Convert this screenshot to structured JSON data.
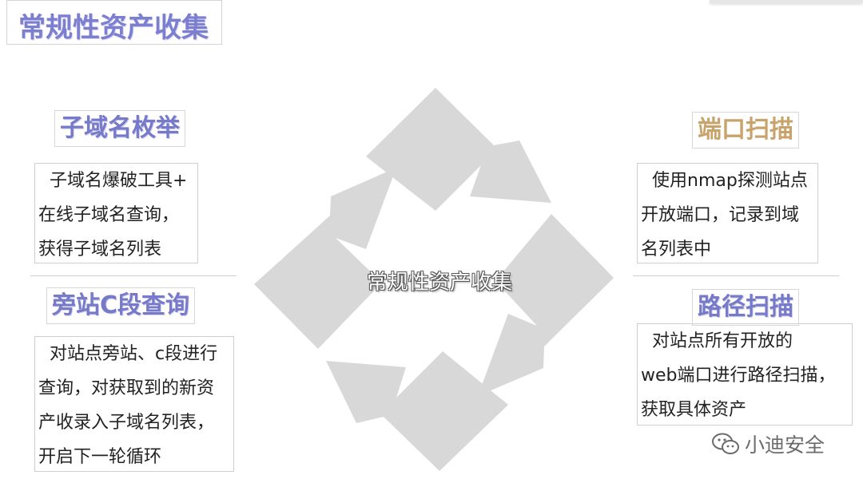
{
  "title": "常规性资产收集",
  "center_label": "常规性资产收集",
  "sections": {
    "subdomain": {
      "heading": "子域名枚举",
      "lines": [
        "子域名爆破工具+",
        "在线子域名查询，",
        "获得子域名列表"
      ]
    },
    "side_c": {
      "heading": "旁站C段查询",
      "lines": [
        "对站点旁站、c段进行",
        "查询，对获取到的新资",
        "产收录入子域名列表，",
        "开启下一轮循环"
      ]
    },
    "port_scan": {
      "heading": "端口扫描",
      "lines": [
        "使用nmap探测站点",
        "开放端口，记录到域",
        "名列表中"
      ]
    },
    "path_scan": {
      "heading": "路径扫描",
      "lines": [
        "对站点所有开放的",
        "web端口进行路径扫描，",
        "获取具体资产"
      ]
    }
  },
  "watermark": "小迪安全",
  "colors": {
    "heading_blue": "#7779c9",
    "heading_brown": "#c8a46c",
    "arrow_gray": "#d8d8d8"
  }
}
